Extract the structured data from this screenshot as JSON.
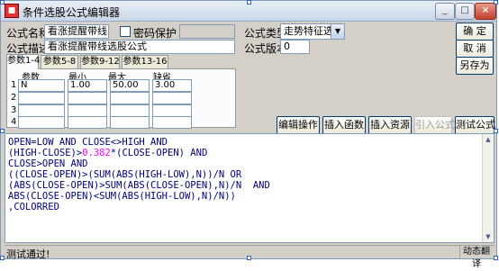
{
  "window": {
    "title": "条件选股公式编辑器",
    "buttons": {
      "minimize": "_",
      "maximize": "□",
      "close": "×"
    }
  },
  "form": {
    "name_label": "公式名称",
    "name_value": "看涨提醒带线",
    "password_label": "密码保护",
    "password_checked": false,
    "password_value": "",
    "type_label": "公式类型",
    "type_value": "走势特征选股",
    "desc_label": "公式描述",
    "desc_value": "看涨提醒带线选股公式",
    "version_label": "公式版本",
    "version_value": "0"
  },
  "right_buttons": {
    "ok": "确 定",
    "cancel": "取 消",
    "save_as": "另存为"
  },
  "param_tabs": [
    "参数1-4",
    "参数5-8",
    "参数9-12",
    "参数13-16"
  ],
  "param_headers": {
    "name": "参数",
    "min": "最小",
    "max": "最大",
    "default": "缺省"
  },
  "params": [
    {
      "row": "1",
      "name": "N",
      "min": "1.00",
      "max": "50.00",
      "default": "3.00"
    },
    {
      "row": "2",
      "name": "",
      "min": "",
      "max": "",
      "default": ""
    },
    {
      "row": "3",
      "name": "",
      "min": "",
      "max": "",
      "default": ""
    },
    {
      "row": "4",
      "name": "",
      "min": "",
      "max": "",
      "default": ""
    }
  ],
  "tool_buttons": {
    "edit_op": "编辑操作",
    "insert_func": "插入函数",
    "insert_res": "插入资源",
    "import_formula": "引入公式",
    "test_formula": "测试公式"
  },
  "code_lines": [
    {
      "pre": "OPEN=LOW AND CLOSE<>HIGH AND",
      "num": "",
      "post": ""
    },
    {
      "pre": "(HIGH-CLOSE)>",
      "num": "0.382",
      "post": "*(CLOSE-OPEN) AND"
    },
    {
      "pre": "CLOSE>OPEN AND",
      "num": "",
      "post": ""
    },
    {
      "pre": "((CLOSE-OPEN)>(SUM(ABS(HIGH-LOW),N))/N OR",
      "num": "",
      "post": ""
    },
    {
      "pre": "(ABS(CLOSE-OPEN)>SUM(ABS(CLOSE-OPEN),N)/N  AND",
      "num": "",
      "post": ""
    },
    {
      "pre": "ABS(CLOSE-OPEN)<SUM(ABS(HIGH-LOW),N)/N))",
      "num": "",
      "post": ""
    },
    {
      "pre": ",COLORRED",
      "num": "",
      "post": ""
    }
  ],
  "status": {
    "message": "测试通过!",
    "right": "动态翻译"
  },
  "colors": {
    "code_text": "#000080",
    "code_number": "#ff00ff",
    "close_button": "#c0412a"
  }
}
